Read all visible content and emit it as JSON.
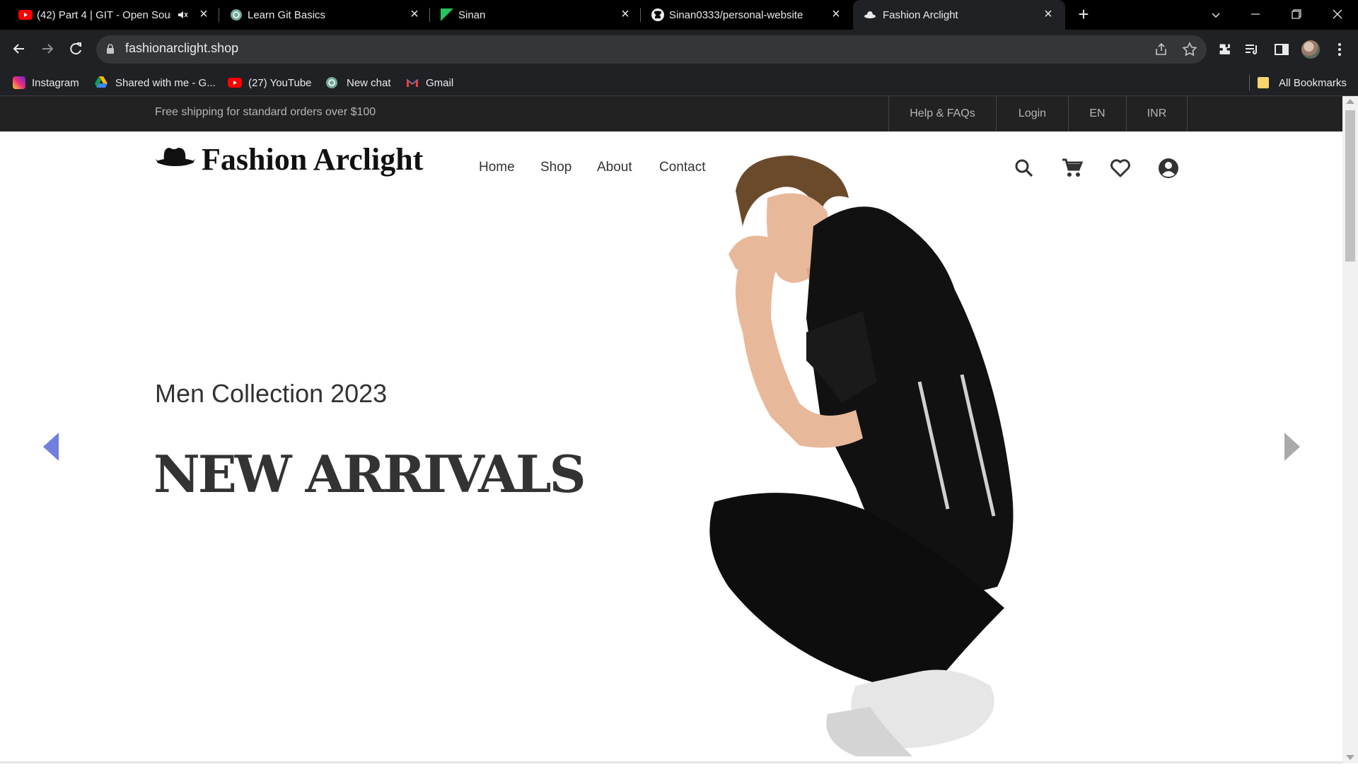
{
  "browser": {
    "tabs": [
      {
        "title": "(42) Part 4 | GIT - Open Sour",
        "icon": "youtube-icon",
        "active": false
      },
      {
        "title": "Learn Git Basics",
        "icon": "chatgpt-icon",
        "active": false
      },
      {
        "title": "Sinan",
        "icon": "green-flag-icon",
        "active": false
      },
      {
        "title": "Sinan0333/personal-website",
        "icon": "github-icon",
        "active": false
      },
      {
        "title": "Fashion Arclight",
        "icon": "hat-icon",
        "active": true
      }
    ],
    "url": "fashionarclight.shop",
    "bookmarks": [
      {
        "label": "Instagram",
        "icon": "instagram-icon"
      },
      {
        "label": "Shared with me - G...",
        "icon": "google-drive-icon"
      },
      {
        "label": "(27) YouTube",
        "icon": "youtube-icon"
      },
      {
        "label": "New chat",
        "icon": "chatgpt-icon"
      },
      {
        "label": "Gmail",
        "icon": "gmail-icon"
      }
    ],
    "all_bookmarks": "All Bookmarks"
  },
  "site": {
    "topbar": {
      "shipping": "Free shipping for standard orders over $100",
      "links": [
        "Help & FAQs",
        "Login",
        "EN",
        "INR"
      ]
    },
    "brand": "Fashion Arclight",
    "nav": [
      "Home",
      "Shop",
      "About",
      "Contact"
    ],
    "hero": {
      "subtitle": "Men Collection 2023",
      "title": "NEW ARRIVALS"
    },
    "colors": {
      "topbar_bg": "#222222",
      "prev_arrow": "#717fe0",
      "next_arrow": "#aaaaaa"
    }
  }
}
